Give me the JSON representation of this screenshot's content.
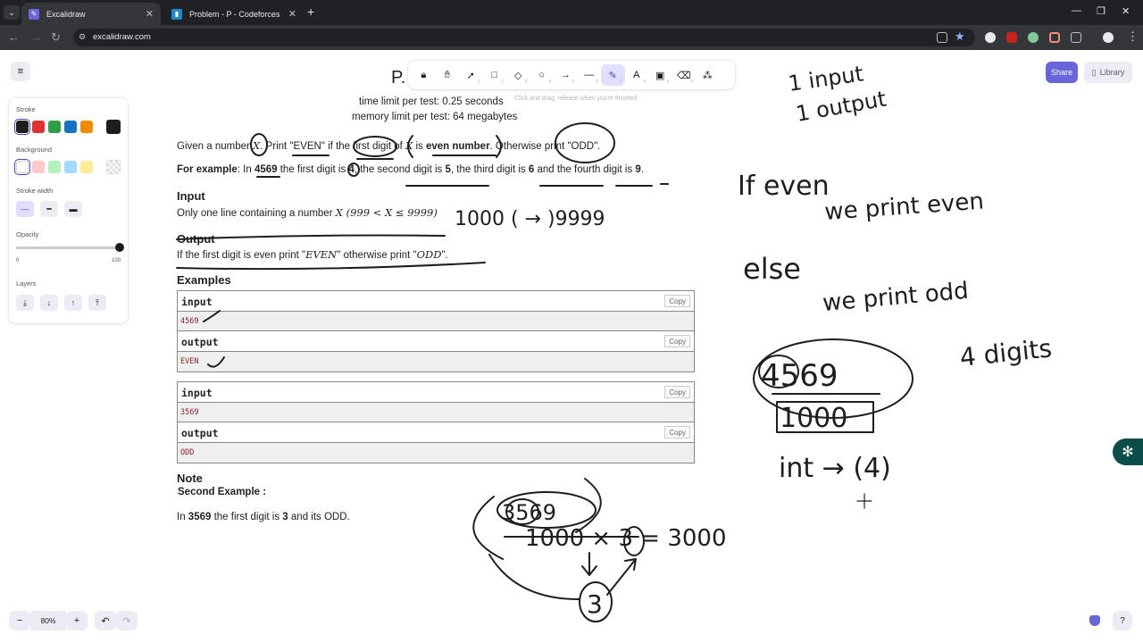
{
  "browser": {
    "tabs": [
      {
        "title": "Excalidraw",
        "active": true
      },
      {
        "title": "Problem - P - Codeforces",
        "active": false
      }
    ],
    "url": "excalidraw.com"
  },
  "excalidraw": {
    "toolbar_keys": [
      "",
      "",
      "1",
      "2",
      "3",
      "4",
      "5",
      "6",
      "7",
      "8",
      "9",
      "0",
      ""
    ],
    "share_label": "Share",
    "library_label": "Library",
    "hint": "Click and drag, release when you're finished",
    "props": {
      "stroke_title": "Stroke",
      "background_title": "Background",
      "stroke_width_title": "Stroke width",
      "opacity_title": "Opacity",
      "opacity_min": "0",
      "opacity_max": "100",
      "opacity_value": 1.0,
      "layers_title": "Layers",
      "stroke_colors": [
        "#1e1e1e",
        "#e03131",
        "#2f9e44",
        "#1971c2",
        "#f08c00"
      ],
      "current_stroke": "#1e1e1e",
      "background_colors": [
        "#ffffff",
        "#ffc9c9",
        "#b2f2bb",
        "#a5d8ff",
        "#ffec99"
      ]
    },
    "zoom": "80%"
  },
  "problem": {
    "title_fragment": "P.",
    "time_limit": "time limit per test: 0.25 seconds",
    "memory_limit": "memory limit per test: 64 megabytes",
    "statement_pre": "Given a number",
    "statement_var": "X",
    "statement_mid": ". Print \"EVEN\" if the first digit of",
    "statement_var2": "X",
    "statement_mid2": "is",
    "statement_bold": "even number",
    "statement_post": ". Otherwise print \"ODD\".",
    "example_label": "For example",
    "example_text_1": ": In",
    "example_num": "4569",
    "example_text_2": "the first digit is",
    "example_d1": "4",
    "example_text_3": ", the second digit is",
    "example_d2": "5",
    "example_text_4": ", the third digit is",
    "example_d3": "6",
    "example_text_5": "and the fourth digit is",
    "example_d4": "9",
    "example_text_6": ".",
    "input_header": "Input",
    "input_text": "Only one line containing a number",
    "input_constraint": "X (999 < X ≤ 9999)",
    "output_header": "Output",
    "output_text_1": "If the first digit is even print \"",
    "output_even": "EVEN",
    "output_text_2": "\" otherwise print \"",
    "output_odd": "ODD",
    "output_text_3": "\".",
    "examples_header": "Examples",
    "examples": [
      {
        "input_label": "input",
        "input": "4569",
        "output_label": "output",
        "output": "EVEN"
      },
      {
        "input_label": "input",
        "input": "3569",
        "output_label": "output",
        "output": "ODD"
      }
    ],
    "copy_label": "Copy",
    "note_header": "Note",
    "note_sub": "Second Example :",
    "note_text_1": "In",
    "note_num": "3569",
    "note_text_2": "the first digit is",
    "note_d": "3",
    "note_text_3": "and its ODD."
  },
  "handwriting": {
    "top_right": [
      "1 input",
      "1 output"
    ],
    "if_line": "If even",
    "we_print_even": "we print even",
    "else_line": "else",
    "we_print_odd": "we print odd",
    "digits_note": "4 digits",
    "circled_number": "4569",
    "boxed_number": "1000",
    "int_line": "int → (4)",
    "middle_number": "1000 ( → )9999",
    "bottom_number": "3569",
    "bottom_calc": "1000 × 3 = 3000",
    "bottom_circle": "3"
  }
}
